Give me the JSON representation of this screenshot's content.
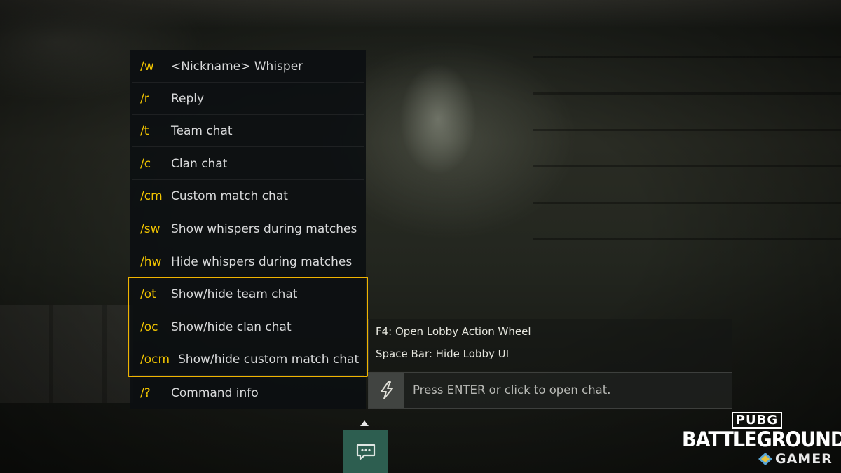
{
  "commands": [
    {
      "key": "/w",
      "desc": "<Nickname> Whisper"
    },
    {
      "key": "/r",
      "desc": "Reply"
    },
    {
      "key": "/t",
      "desc": "Team chat"
    },
    {
      "key": "/c",
      "desc": "Clan chat"
    },
    {
      "key": "/cm",
      "desc": "Custom match chat"
    },
    {
      "key": "/sw",
      "desc": "Show whispers during matches"
    },
    {
      "key": "/hw",
      "desc": "Hide whispers during matches"
    },
    {
      "key": "/ot",
      "desc": "Show/hide team chat"
    },
    {
      "key": "/oc",
      "desc": "Show/hide clan chat"
    },
    {
      "key": "/ocm",
      "desc": "Show/hide custom match chat"
    },
    {
      "key": "/?",
      "desc": "Command info"
    }
  ],
  "tips": {
    "f4": "F4: Open Lobby Action Wheel",
    "space": "Space Bar: Hide Lobby UI"
  },
  "chat": {
    "placeholder": "Press ENTER or click to open chat."
  },
  "logo": {
    "pubg": "PUBG",
    "battlegrounds": "BATTLEGROUNDS",
    "gamer": "GAMER"
  },
  "colors": {
    "command_key": "#f2c500",
    "highlight": "#f0b400",
    "chat_toggle": "#2d5e50"
  }
}
